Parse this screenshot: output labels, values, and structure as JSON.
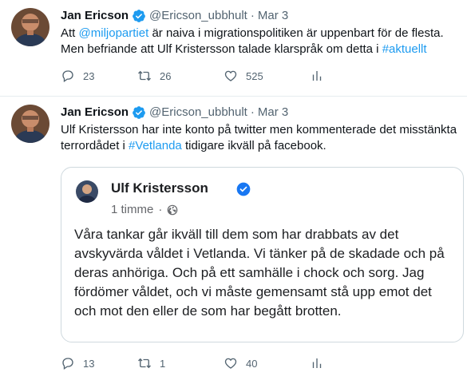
{
  "tweets": [
    {
      "author_name": "Jan Ericson",
      "handle": "@Ericson_ubbhult",
      "separator": "·",
      "date": "Mar 3",
      "text_parts": {
        "p1": "Att ",
        "mention": "@miljopartiet",
        "p2": " är naiva i migrationspolitiken är uppenbart för de flesta. Men befriande att Ulf Kristersson talade klarspråk om detta i ",
        "hashtag": "#aktuellt"
      },
      "replies": "23",
      "retweets": "26",
      "likes": "525"
    },
    {
      "author_name": "Jan Ericson",
      "handle": "@Ericson_ubbhult",
      "separator": "·",
      "date": "Mar 3",
      "text_parts": {
        "p1": "Ulf Kristersson har inte konto på twitter men kommenterade det misstänkta terrordådet i ",
        "hashtag": "#Vetlanda",
        "p2": " tidigare ikväll på facebook."
      },
      "replies": "13",
      "retweets": "1",
      "likes": "40",
      "embedded_post": {
        "author": "Ulf Kristersson",
        "time": "1 timme",
        "separator": "·",
        "text": "Våra tankar går ikväll till dem som har drabbats av det avskyvärda våldet i Vetlanda. Vi tänker på de skadade och på deras anhöriga. Och på ett samhälle i chock och sorg. Jag fördömer våldet, och vi måste gemensamt stå upp emot det och mot den eller de som har begått brotten."
      }
    }
  ],
  "colors": {
    "link": "#1d9bf0",
    "muted": "#536471",
    "verified": "#1d9bf0",
    "divider": "#e6ecf0"
  }
}
